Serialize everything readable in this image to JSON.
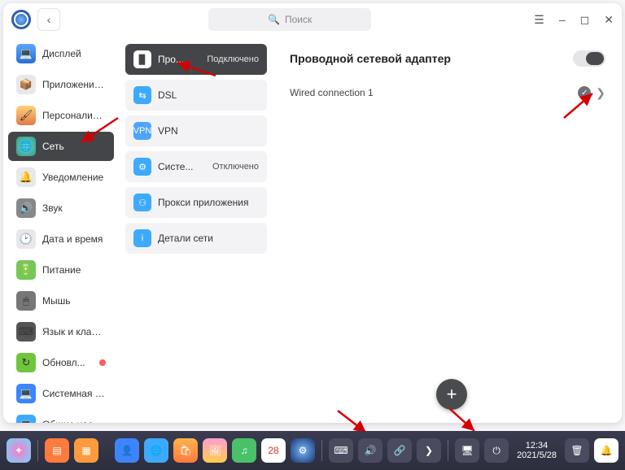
{
  "titlebar": {
    "search_placeholder": "Поиск"
  },
  "sidebar": {
    "items": [
      {
        "label": "Дисплей"
      },
      {
        "label": "Приложения ..."
      },
      {
        "label": "Персонализа..."
      },
      {
        "label": "Сеть",
        "active": true
      },
      {
        "label": "Уведомление"
      },
      {
        "label": "Звук"
      },
      {
        "label": "Дата и время"
      },
      {
        "label": "Питание"
      },
      {
        "label": "Мышь"
      },
      {
        "label": "Язык и клави..."
      },
      {
        "label": "Обновл...",
        "badge": true
      },
      {
        "label": "Системная ин..."
      },
      {
        "label": "Общие настр..."
      }
    ]
  },
  "midpanel": {
    "items": [
      {
        "label": "Про...",
        "status": "Подключено",
        "active": true,
        "icon": "ethernet"
      },
      {
        "label": "DSL",
        "icon": "dsl"
      },
      {
        "label": "VPN",
        "icon": "vpn"
      },
      {
        "label": "Систе...",
        "status": "Отключено",
        "icon": "proxy"
      },
      {
        "label": "Прокси приложения",
        "icon": "app-proxy"
      },
      {
        "label": "Детали сети",
        "icon": "info"
      }
    ]
  },
  "content": {
    "title": "Проводной сетевой адаптер",
    "toggle_on": true,
    "connections": [
      {
        "name": "Wired connection 1",
        "connected": true
      }
    ],
    "fab": "+"
  },
  "dock": {
    "time": "12:34",
    "date": "2021/5/28",
    "calendar_day": "28"
  }
}
